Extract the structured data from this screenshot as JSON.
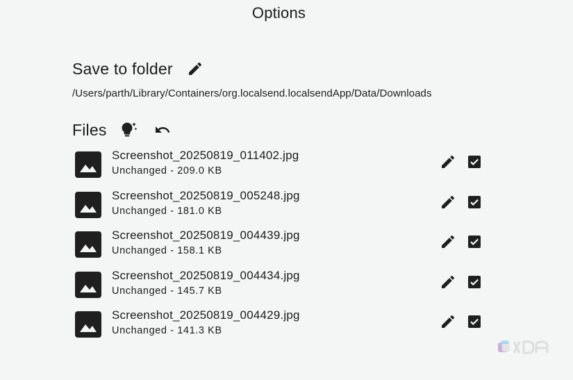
{
  "title": "Options",
  "save_folder": {
    "heading": "Save to folder",
    "path": "/Users/parth/Library/Containers/org.localsend.localsendApp/Data/Downloads",
    "edit_icon": "pencil-icon"
  },
  "files": {
    "heading": "Files",
    "actions": [
      {
        "icon": "lightbulb-sparkle-icon"
      },
      {
        "icon": "undo-icon"
      }
    ],
    "items": [
      {
        "name": "Screenshot_20250819_011402.jpg",
        "status": "Unchanged - 209.0 KB",
        "checked": true
      },
      {
        "name": "Screenshot_20250819_005248.jpg",
        "status": "Unchanged - 181.0 KB",
        "checked": true
      },
      {
        "name": "Screenshot_20250819_004439.jpg",
        "status": "Unchanged - 158.1 KB",
        "checked": true
      },
      {
        "name": "Screenshot_20250819_004434.jpg",
        "status": "Unchanged - 145.7 KB",
        "checked": true
      },
      {
        "name": "Screenshot_20250819_004429.jpg",
        "status": "Unchanged - 141.3 KB",
        "checked": true
      }
    ]
  },
  "watermark": {
    "logo": "XDA",
    "icon": "xda-logo"
  },
  "colors": {
    "background": "#f4f6f6",
    "text": "#1b1b1b",
    "icon": "#1f1f1f"
  }
}
